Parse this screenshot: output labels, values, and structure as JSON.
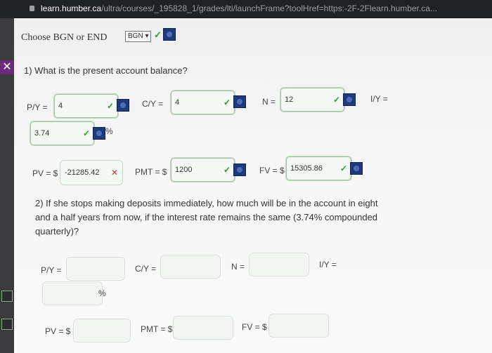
{
  "browser": {
    "url_host": "learn.humber.ca",
    "url_path": "/ultra/courses/_195828_1/grades/lti/launchFrame?toolHref=https:-2F-2Flearn.humber.ca..."
  },
  "header": {
    "choose_text": "Choose BGN or END",
    "bgn_select_value": "BGN"
  },
  "close_icon_glyph": "✕",
  "q1": {
    "text": "1) What is the present account balance?",
    "py_label": "P/Y =",
    "py_value": "4",
    "cy_label": "C/Y =",
    "cy_value": "4",
    "n_label": "N =",
    "n_value": "12",
    "iy_label": "I/Y =",
    "iy_value": "3.74",
    "pct_sign": "%",
    "pv_label": "PV = $",
    "pv_value": "-21285.42",
    "pmt_label": "PMT = $",
    "pmt_value": "1200",
    "fv_label": "FV = $",
    "fv_value": "15305.86"
  },
  "q2": {
    "text": "2) If she stops making deposits immediately, how much will be in the account in eight and a half years from now, if the interest rate remains the same (3.74% compounded quarterly)?",
    "py_label": "P/Y =",
    "cy_label": "C/Y =",
    "n_label": "N =",
    "iy_label": "I/Y =",
    "pct_sign": "%",
    "pv_label": "PV = $",
    "pmt_label": "PMT = $",
    "fv_label": "FV = $"
  },
  "colors": {
    "check": "#2a9d2a",
    "error": "#c0392b",
    "key_icon": "#1f3a7a"
  }
}
